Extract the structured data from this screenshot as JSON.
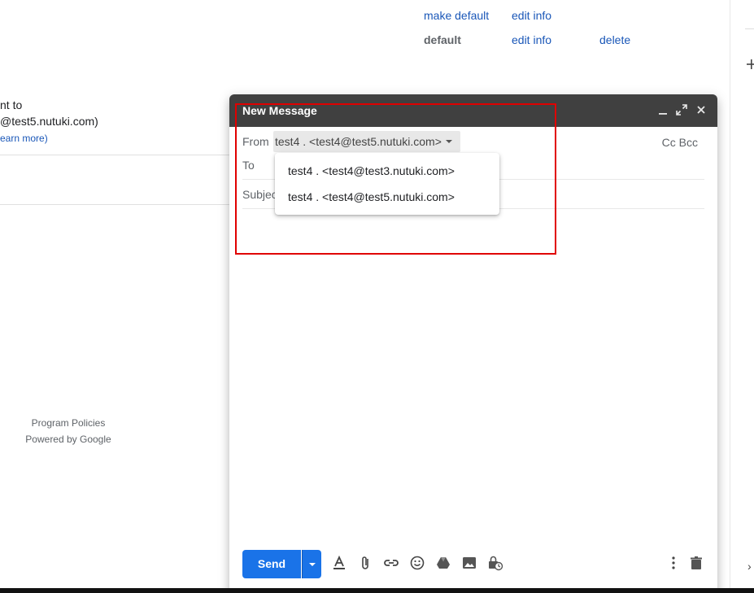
{
  "settings": {
    "row1": {
      "make_default": "make default",
      "edit_info": "edit info"
    },
    "row2": {
      "default_label": "default",
      "edit_info": "edit info",
      "delete": "delete"
    },
    "partial_line1": "nt to",
    "partial_line2": "@test5.nutuki.com)",
    "partial_link": "earn more)"
  },
  "footer": {
    "program_policies": "Program Policies",
    "powered_by": "Powered by Google"
  },
  "compose": {
    "title": "New Message",
    "icons": {
      "minimize": "minimize-icon",
      "fullscreen": "fullscreen-icon",
      "close": "close-icon"
    },
    "from_label": "From",
    "from_value": "test4 . <test4@test5.nutuki.com>",
    "to_label": "To",
    "subject_label": "Subject",
    "cc_bcc": "Cc Bcc",
    "from_options": [
      "test4 . <test4@test3.nutuki.com>",
      "test4 . <test4@test5.nutuki.com>"
    ],
    "send_label": "Send"
  },
  "colors": {
    "accent": "#1a73e8",
    "header": "#404040",
    "highlight": "#e00000",
    "link": "#1a57b8"
  }
}
